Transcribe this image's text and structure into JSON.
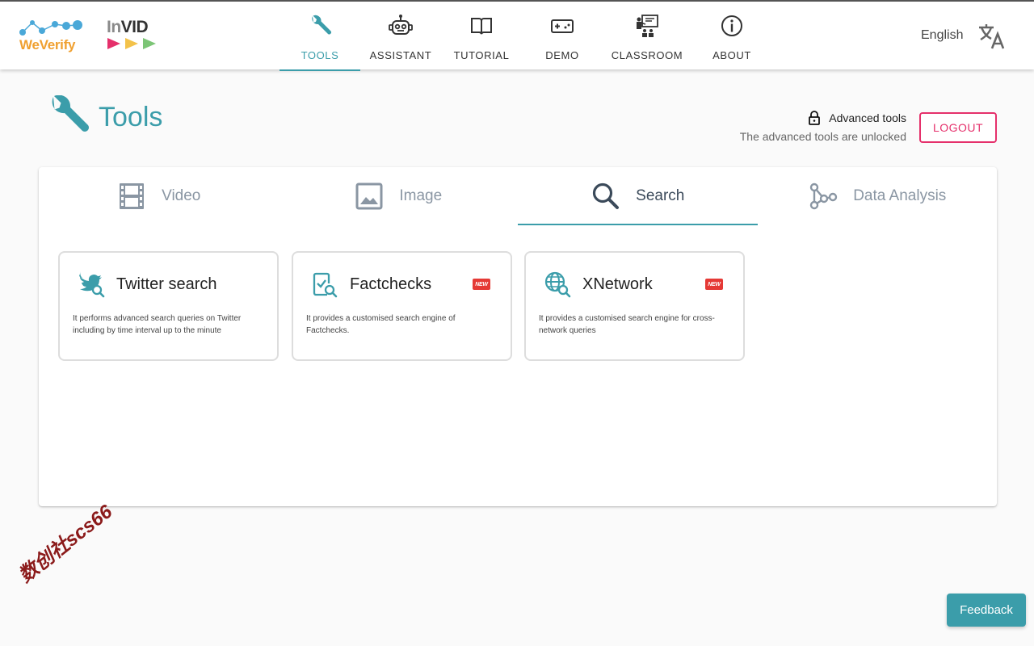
{
  "brand": {
    "weverify_logo": "WeVerify",
    "invid_logo_prefix": "In",
    "invid_logo_suffix": "VID"
  },
  "nav": {
    "items": [
      {
        "label": "TOOLS",
        "icon": "wrench-icon",
        "active": true
      },
      {
        "label": "ASSISTANT",
        "icon": "robot-icon",
        "active": false
      },
      {
        "label": "TUTORIAL",
        "icon": "book-icon",
        "active": false
      },
      {
        "label": "DEMO",
        "icon": "gamepad-icon",
        "active": false
      },
      {
        "label": "CLASSROOM",
        "icon": "classroom-icon",
        "active": false
      },
      {
        "label": "ABOUT",
        "icon": "info-icon",
        "active": false
      }
    ]
  },
  "header": {
    "language": "English"
  },
  "page": {
    "title": "Tools",
    "advanced_label": "Advanced tools",
    "advanced_status": "The advanced tools are unlocked",
    "logout_label": "LOGOUT"
  },
  "tabs": [
    {
      "label": "Video",
      "icon": "film-icon",
      "active": false
    },
    {
      "label": "Image",
      "icon": "image-icon",
      "active": false
    },
    {
      "label": "Search",
      "icon": "search-icon",
      "active": true
    },
    {
      "label": "Data Analysis",
      "icon": "graph-icon",
      "active": false
    }
  ],
  "tools": [
    {
      "title": "Twitter search",
      "description": "It performs advanced search queries on Twitter including by time interval up to the minute",
      "badge": "",
      "icon": "twitter-search-icon"
    },
    {
      "title": "Factchecks",
      "description": "It provides a customised search engine of Factchecks.",
      "badge": "NEW",
      "icon": "factcheck-search-icon"
    },
    {
      "title": "XNetwork",
      "description": "It provides a customised search engine for cross-network queries",
      "badge": "NEW",
      "icon": "globe-search-icon"
    }
  ],
  "colors": {
    "accent": "#3b9daa",
    "logout": "#e5306b",
    "badge": "#e53935",
    "weverify_orange": "#f0a030"
  },
  "feedback_label": "Feedback",
  "watermark": "数创社scs66"
}
